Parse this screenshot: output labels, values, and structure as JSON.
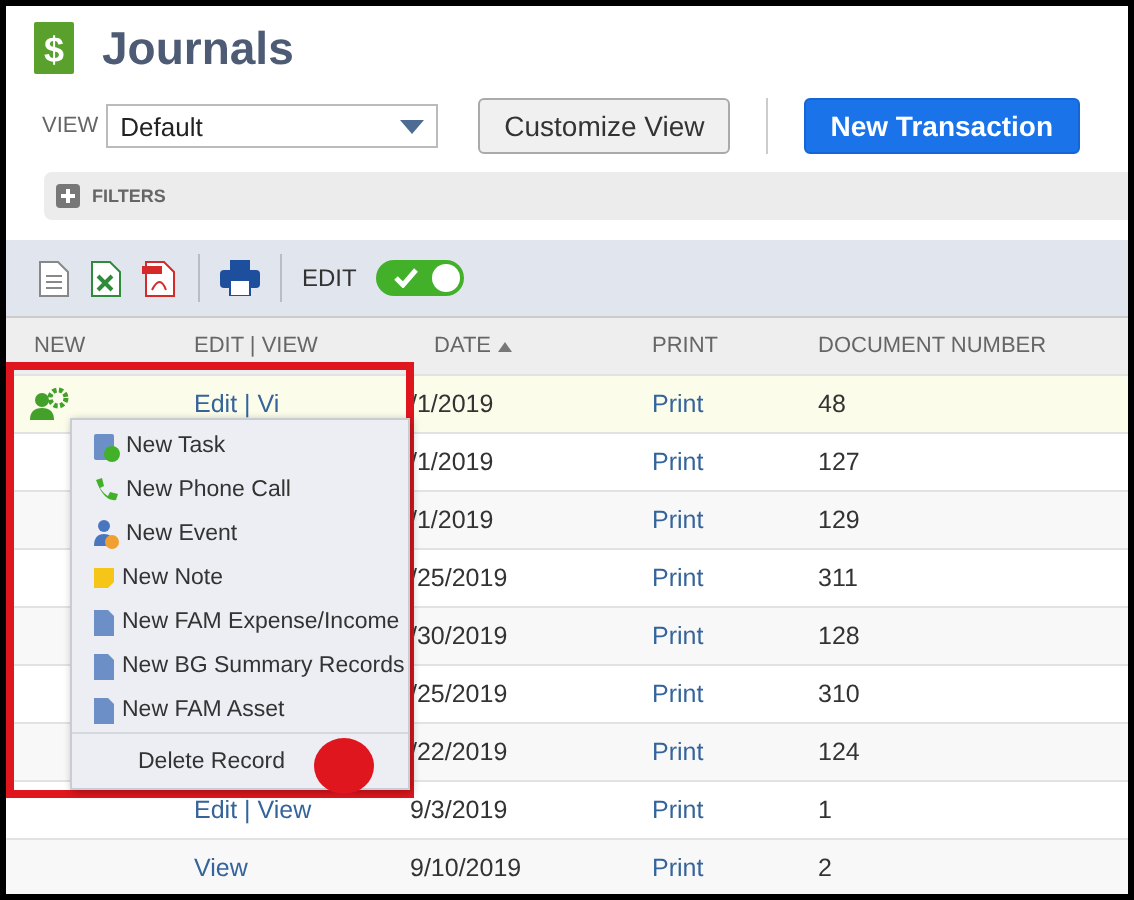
{
  "header": {
    "logo_glyph": "$",
    "title": "Journals"
  },
  "view": {
    "label": "VIEW",
    "value": "Default"
  },
  "buttons": [
    {
      "label": "Customize View",
      "kind": "secondary"
    },
    {
      "label": "New Transaction",
      "kind": "primary"
    }
  ],
  "filters": {
    "label": "FILTERS",
    "expanded": false
  },
  "toolbar": {
    "edit_label": "EDIT",
    "edit_on": true
  },
  "table": {
    "columns": [
      {
        "label": "NEW",
        "sorted": false
      },
      {
        "label": "EDIT | VIEW",
        "sorted": false
      },
      {
        "label": "DATE",
        "sorted": true
      },
      {
        "label": "PRINT",
        "sorted": false
      },
      {
        "label": "DOCUMENT NUMBER",
        "sorted": false
      }
    ],
    "rows": [
      {
        "highlighted": true,
        "edit_view": "Edit | Vi",
        "date": "/1/2019",
        "print": "Print",
        "document_number": "48"
      },
      {
        "highlighted": false,
        "date": "/1/2019",
        "print": "Print",
        "document_number": "127"
      },
      {
        "highlighted": false,
        "date": "/1/2019",
        "print": "Print",
        "document_number": "129"
      },
      {
        "highlighted": false,
        "date": "/25/2019",
        "print": "Print",
        "document_number": "311"
      },
      {
        "highlighted": false,
        "date": "/30/2019",
        "print": "Print",
        "document_number": "128"
      },
      {
        "highlighted": false,
        "date": "/25/2019",
        "print": "Print",
        "document_number": "310"
      },
      {
        "highlighted": false,
        "date": "/22/2019",
        "print": "Print",
        "document_number": "124"
      },
      {
        "highlighted": false,
        "edit_view": "Edit | View",
        "date": "9/3/2019",
        "print": "Print",
        "document_number": "1"
      },
      {
        "highlighted": false,
        "edit_view": "View",
        "date": "9/10/2019",
        "print": "Print",
        "document_number": "2"
      }
    ]
  },
  "context_menu": {
    "items": [
      {
        "label": "New Task",
        "kind": "task"
      },
      {
        "label": "New Phone Call",
        "kind": "phone"
      },
      {
        "label": "New Event",
        "kind": "event"
      },
      {
        "label": "New Note",
        "kind": "note"
      },
      {
        "label": "New FAM Expense/Income",
        "kind": "document"
      },
      {
        "label": "New BG Summary Records",
        "kind": "document"
      },
      {
        "label": "New FAM Asset",
        "kind": "document"
      },
      {
        "label": "Delete Record",
        "kind": "action"
      }
    ]
  }
}
